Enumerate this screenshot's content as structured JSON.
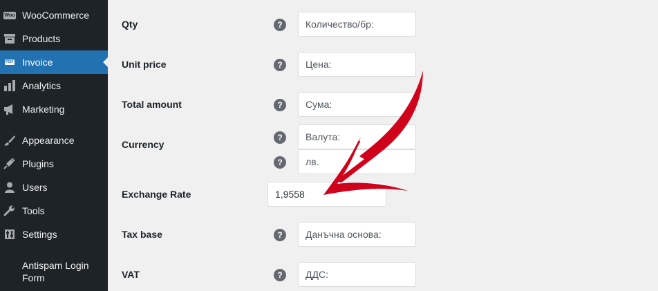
{
  "sidebar": {
    "items": [
      {
        "label": "WooCommerce",
        "icon": "woocommerce-icon"
      },
      {
        "label": "Products",
        "icon": "products-icon"
      },
      {
        "label": "Invoice",
        "icon": "pdf-icon",
        "active": true
      },
      {
        "label": "Analytics",
        "icon": "analytics-icon"
      },
      {
        "label": "Marketing",
        "icon": "megaphone-icon"
      },
      {
        "label": "Appearance",
        "icon": "brush-icon"
      },
      {
        "label": "Plugins",
        "icon": "plugin-icon"
      },
      {
        "label": "Users",
        "icon": "user-icon"
      },
      {
        "label": "Tools",
        "icon": "wrench-icon"
      },
      {
        "label": "Settings",
        "icon": "settings-icon"
      },
      {
        "label": "Antispam Login Form",
        "icon": ""
      }
    ],
    "woo_badge": "Woo",
    "pdf_badge": "PDF"
  },
  "form": {
    "qty": {
      "label": "Qty",
      "value": "Количество/бр:"
    },
    "unit_price": {
      "label": "Unit price",
      "value": "Цена:"
    },
    "total_amount": {
      "label": "Total amount",
      "value": "Сума:"
    },
    "currency": {
      "label": "Currency",
      "value": "Валута:",
      "symbol": "лв."
    },
    "exchange_rate": {
      "label": "Exchange Rate",
      "value": "1,9558"
    },
    "tax_base": {
      "label": "Tax base",
      "value": "Данъчна основа:"
    },
    "vat": {
      "label": "VAT",
      "value": "ДДС:"
    },
    "help_glyph": "?"
  },
  "colors": {
    "sidebar_bg": "#1d2327",
    "active_bg": "#2271b1",
    "page_bg": "#f0f0f1",
    "arrow": "#d0021b"
  }
}
